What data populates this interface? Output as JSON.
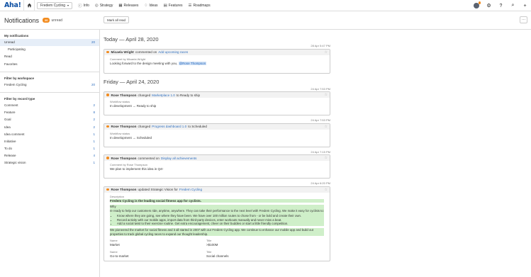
{
  "topbar": {
    "logo": "Aha!",
    "workspace": "Fredem Cycling",
    "nav": [
      {
        "label": "Info",
        "icon": "info-icon"
      },
      {
        "label": "Strategy",
        "icon": "target-icon"
      },
      {
        "label": "Releases",
        "icon": "calendar-icon"
      },
      {
        "label": "Ideas",
        "icon": "lightbulb-icon"
      },
      {
        "label": "Features",
        "icon": "grid-icon"
      },
      {
        "label": "Roadmaps",
        "icon": "roadmap-icon"
      }
    ]
  },
  "header": {
    "title": "Notifications",
    "unread_count": "20",
    "unread_label": "unread",
    "mark_all_read": "Mark all read",
    "more": "···"
  },
  "sidebar": {
    "my_notifications": "My notifications",
    "items": [
      {
        "label": "Unread",
        "count": "20"
      },
      {
        "label": "Participating",
        "count": ""
      },
      {
        "label": "Read",
        "count": ""
      },
      {
        "label": "Favorites",
        "count": ""
      }
    ],
    "filter_workspace": "Filter by workspace",
    "workspaces": [
      {
        "label": "Fredem Cycling",
        "count": "20"
      }
    ],
    "filter_record": "Filter by record type",
    "records": [
      {
        "label": "Comment",
        "count": "2"
      },
      {
        "label": "Feature",
        "count": "8"
      },
      {
        "label": "Goal",
        "count": "2"
      },
      {
        "label": "Idea",
        "count": "2"
      },
      {
        "label": "Idea comment",
        "count": "1"
      },
      {
        "label": "Initiative",
        "count": "1"
      },
      {
        "label": "To do",
        "count": "1"
      },
      {
        "label": "Release",
        "count": "4"
      },
      {
        "label": "Strategic vision",
        "count": "1"
      }
    ]
  },
  "days": {
    "today": "Today — April 28, 2020",
    "friday": "Friday — April 24, 2020"
  },
  "n1": {
    "time": "28 Apr 5:47 PM",
    "actor": "Micaela Wright",
    "action": "commented on",
    "target": "Add upcoming races",
    "label": "Comment by Micaela Wright",
    "text": "Looking forward to the design meeting with you,",
    "mention": "@Rose Thompson"
  },
  "n2": {
    "time": "24 Apr 7:53 PM",
    "actor": "Rose Thompson",
    "action": "changed",
    "target": "Marketplace 1.0",
    "suffix": "to Ready to ship",
    "label": "Workflow status",
    "text": "In development → Ready to ship"
  },
  "n3": {
    "time": "24 Apr 7:53 PM",
    "actor": "Rose Thompson",
    "action": "changed",
    "target": "Progress dashboard 1.0",
    "suffix": "to Scheduled",
    "label": "Workflow status",
    "text": "In development → Scheduled"
  },
  "n4": {
    "time": "24 Apr 7:15 PM",
    "actor": "Rose Thompson",
    "action": "commented on",
    "target": "Display all achievements",
    "label": "Comment by Rose Thompson",
    "text": "We plan to implement this idea in Q4!"
  },
  "n5": {
    "time": "24 Apr 6:20 PM",
    "actor": "Rose Thompson",
    "action": "updated Strategic Vision for",
    "target": "Fredem Cycling",
    "label": "Description",
    "headline": "Fredem Cycling is the leading social fitness app for cyclists.",
    "why": "Why",
    "para1": "re ready to help our customers ride, anytime, anywhere. They can take their performance to the next level with Fredem Cycling. We make it easy for cyclists to:",
    "bullets": [
      "Know where they are going, see where they have been. We have over 100 million routes to chose from - or be bold and create their own.",
      "Record activity with our mobile apps, import data from third-party devices, enter workouts manually and never miss a beat.",
      "Add a social twist to their exercise routine. Get extra encouragement, cheer on their buddies or start a little friendly competition."
    ],
    "para2": "We pioneered the market for social fitness and it all started in 2007 with our Fredem Cycling app. We continue to enhance our mobile app and build out properties to track global cycling races to expand our thought leadership.",
    "fields": [
      {
        "name_label": "Name",
        "name": "Market",
        "title_label": "Title",
        "title": ">$100M"
      },
      {
        "name_label": "Name",
        "name": "Go-to-market",
        "title_label": "Title",
        "title": "Social channels"
      }
    ]
  }
}
